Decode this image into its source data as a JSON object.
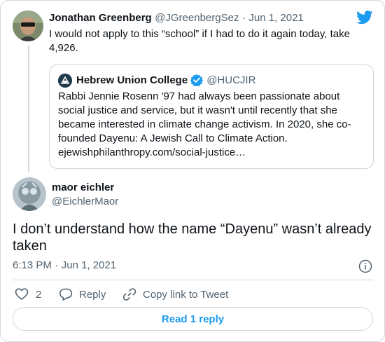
{
  "parent_tweet": {
    "author_name": "Jonathan Greenberg",
    "handle": "@JGreenbergSez",
    "separator": "·",
    "date": "Jun 1, 2021",
    "text_line1": "I would not apply to this “school” if I had to do it again today, take",
    "text_line2": "4,926."
  },
  "quoted_tweet": {
    "author_name": "Hebrew Union College",
    "handle": "@HUCJIR",
    "lines": [
      "Rabbi Jennie Rosenn '97 had always been passionate about",
      "social justice and service, but it wasn't until recently that she",
      "became interested in climate change activism. In 2020, she co-",
      "founded Dayenu: A Jewish Call to Climate Action.",
      "ejewishphilanthropy.com/social-justice…"
    ]
  },
  "main_tweet": {
    "author_name": "maor eichler",
    "handle": "@EichlerMaor",
    "text_line1": "I don’t understand how the name “Dayenu” wasn’t already",
    "text_line2": "taken",
    "time": "6:13 PM",
    "separator": "·",
    "date": "Jun 1, 2021"
  },
  "actions": {
    "like_count": "2",
    "reply_label": "Reply",
    "copy_link_label": "Copy link to Tweet"
  },
  "read_reply_label": "Read 1 reply",
  "colors": {
    "twitter_blue": "#1d9bf0",
    "verified_blue": "#1d9bf0",
    "text": "#0f1419",
    "muted": "#536471",
    "border": "#cfd9de"
  },
  "icons": {
    "brand": "twitter-bird-icon",
    "verified": "verified-badge-icon",
    "info": "info-icon",
    "like": "heart-icon",
    "reply": "reply-bubble-icon",
    "copy_link": "link-icon"
  }
}
